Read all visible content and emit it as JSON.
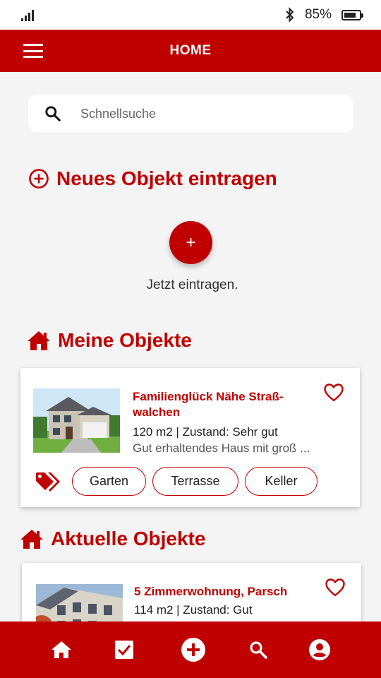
{
  "status_bar": {
    "battery_percent": "85%",
    "battery_level": 0.85,
    "icons": [
      "signal-icon",
      "bluetooth-icon",
      "battery-icon"
    ]
  },
  "app_bar": {
    "title": "HOME",
    "menu_icon": "menu-icon"
  },
  "search": {
    "placeholder": "Schnellsuche",
    "value": ""
  },
  "new_object": {
    "title": "Neues Objekt eintragen",
    "button_label": "+",
    "caption": "Jetzt eintragen."
  },
  "my_objects": {
    "title": "Meine Objekte",
    "items": [
      {
        "title": "Familienglück Nähe Straß-walchen",
        "meta": "120 m2 | Zustand: Sehr gut",
        "description": "Gut erhaltendes Haus mit groß ...",
        "tags": [
          "Garten",
          "Terrasse",
          "Keller"
        ]
      }
    ]
  },
  "current_objects": {
    "title": "Aktuelle Objekte",
    "items": [
      {
        "title": "5 Zimmerwohnung, Parsch",
        "meta": "114 m2 | Zustand: Gut"
      }
    ]
  },
  "bottom_nav": {
    "items": [
      "home-icon",
      "checkbox-icon",
      "add-circle-icon",
      "search-icon",
      "account-icon"
    ]
  },
  "colors": {
    "primary": "#c00000",
    "background": "#f4f4f4"
  }
}
